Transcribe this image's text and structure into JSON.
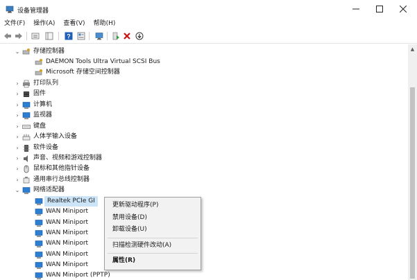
{
  "window": {
    "title": "设备管理器",
    "minimize": "—",
    "maximize": "☐",
    "close": "✕"
  },
  "menu": [
    "文件(F)",
    "操作(A)",
    "查看(V)",
    "帮助(H)"
  ],
  "toolbar_icons": [
    "back-arrow-icon",
    "forward-arrow-icon",
    "properties-icon",
    "show-hide-tree-icon",
    "help-icon",
    "view-icon",
    "monitor-icon",
    "add-driver-icon",
    "uninstall-x-icon",
    "download-icon"
  ],
  "tree": {
    "storage_controllers": {
      "label": "存储控制器",
      "children": [
        "DAEMON Tools Ultra Virtual SCSI Bus",
        "Microsoft 存储空间控制器"
      ]
    },
    "categories": [
      "打印队列",
      "固件",
      "计算机",
      "监视器",
      "键盘",
      "人体学输入设备",
      "软件设备",
      "声音、视频和游戏控制器",
      "鼠标和其他指针设备",
      "通用串行总线控制器"
    ],
    "network_adapters": {
      "label": "网络适配器",
      "children": [
        "Realtek PCIe GI",
        "WAN Miniport",
        "WAN Miniport",
        "WAN Miniport",
        "WAN Miniport",
        "WAN Miniport",
        "WAN Miniport",
        "WAN Miniport (PPTP)"
      ]
    }
  },
  "context_menu": {
    "update_driver": "更新驱动程序(P)",
    "disable_device": "禁用设备(D)",
    "uninstall_device": "卸载设备(U)",
    "scan_hardware": "扫描检测硬件改动(A)",
    "properties": "属性(R)"
  },
  "colors": {
    "selection": "#cce4f7",
    "uninstall_red": "#d01010",
    "driver_green": "#2e9b3a",
    "network_blue": "#2a7fd4"
  }
}
